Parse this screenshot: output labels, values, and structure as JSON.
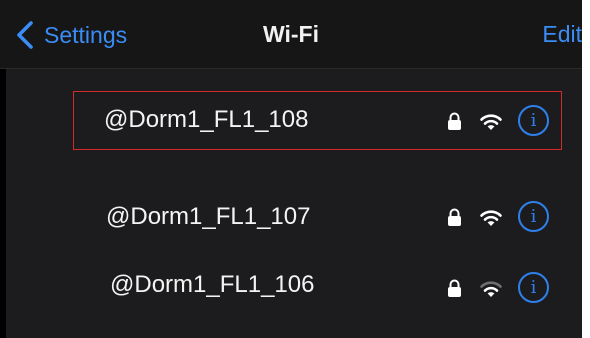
{
  "header": {
    "back_label": "Settings",
    "title": "Wi-Fi",
    "edit_label": "Edit"
  },
  "networks": [
    {
      "name": "@Dorm1_FL1_108",
      "secured": true,
      "signal_bars": 3,
      "selected": true
    },
    {
      "name": "@Dorm1_FL1_107",
      "secured": true,
      "signal_bars": 3,
      "selected": false
    },
    {
      "name": "@Dorm1_FL1_106",
      "secured": true,
      "signal_bars": 2,
      "selected": false
    }
  ],
  "icons": {
    "back": "chevron-left-icon",
    "lock": "lock-icon",
    "wifi": "wifi-icon",
    "info": "info-icon",
    "info_glyph": "i"
  },
  "colors": {
    "accent": "#3b8cf5",
    "info": "#2f80ed",
    "highlight_border": "#d42a2a",
    "background": "#000000",
    "list_background": "#1c1c1e",
    "text": "#f4f4f4",
    "inactive_signal": "#6e6e73"
  }
}
